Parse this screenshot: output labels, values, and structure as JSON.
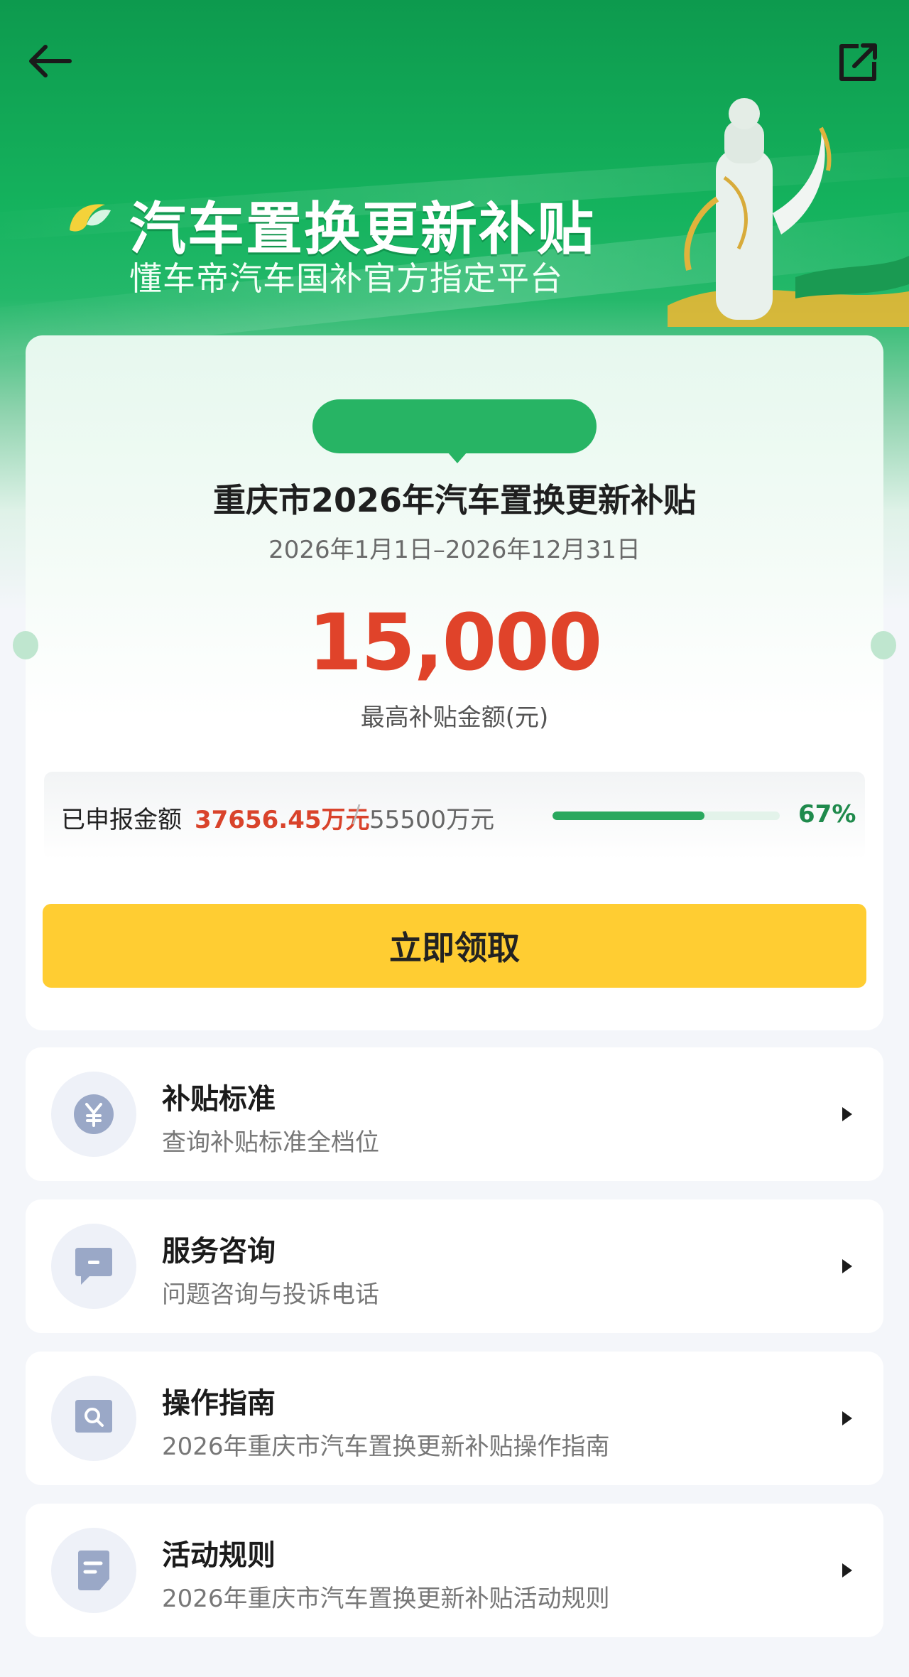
{
  "header": {
    "title": "汽车置换更新补贴",
    "subtitle": "懂车帝汽车国补官方指定平台"
  },
  "card": {
    "badge_text": "",
    "title": "重庆市2026年汽车置换更新补贴",
    "date_range": "2026年1月1日–2026年12月31日",
    "max_amount": "15,000",
    "max_amount_label": "最高补贴金额(元)",
    "progress": {
      "label": "已申报金额",
      "applied": "37656.45万元",
      "separator": "/",
      "total": "55500万元",
      "percent_text": "67%",
      "fraction": 0.67
    },
    "claim_button": "立即领取"
  },
  "menu": [
    {
      "title": "补贴标准",
      "desc": "查询补贴标准全档位",
      "icon": "yen-icon"
    },
    {
      "title": "服务咨询",
      "desc": "问题咨询与投诉电话",
      "icon": "chat-icon"
    },
    {
      "title": "操作指南",
      "desc": "2026年重庆市汽车置换更新补贴操作指南",
      "icon": "search-doc-icon"
    },
    {
      "title": "活动规则",
      "desc": "2026年重庆市汽车置换更新补贴活动规则",
      "icon": "document-icon"
    }
  ],
  "colors": {
    "brand_green": "#15b35e",
    "amount_red": "#e0432a",
    "button_yellow": "#ffcd32",
    "progress_green": "#29a85e"
  }
}
